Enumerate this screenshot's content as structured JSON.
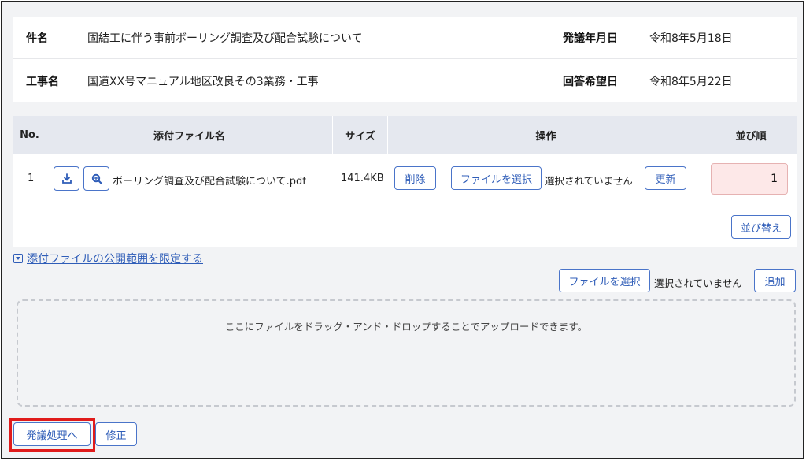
{
  "info": {
    "subject_label": "件名",
    "subject_value": "固結工に伴う事前ボーリング調査及び配合試験について",
    "issue_date_label": "発議年月日",
    "issue_date_value": "令和8年5月18日",
    "work_label": "工事名",
    "work_value": "国道XX号マニュアル地区改良その3業務・工事",
    "reply_date_label": "回答希望日",
    "reply_date_value": "令和8年5月22日"
  },
  "table": {
    "headers": [
      "No.",
      "添付ファイル名",
      "サイズ",
      "操作",
      "並び順"
    ],
    "rows": [
      {
        "no": "1",
        "filename": "ボーリング調査及び配合試験について.pdf",
        "size": "141.4KB",
        "delete_label": "削除",
        "select_label": "ファイルを選択",
        "no_file_label": "選択されていません",
        "update_label": "更新",
        "order": "1"
      }
    ],
    "sort_label": "並び替え"
  },
  "limit_link": "添付ファイルの公開範囲を限定する",
  "upload": {
    "select_label": "ファイルを選択",
    "no_file_label": "選択されていません",
    "add_label": "追加",
    "drop_text": "ここにファイルをドラッグ・アンド・ドロップすることでアップロードできます。"
  },
  "footer": {
    "submit_label": "発議処理へ",
    "edit_label": "修正"
  },
  "colors": {
    "accent": "#2f5db8",
    "highlight": "#e01b1b",
    "order_bg": "#fde8e8"
  }
}
